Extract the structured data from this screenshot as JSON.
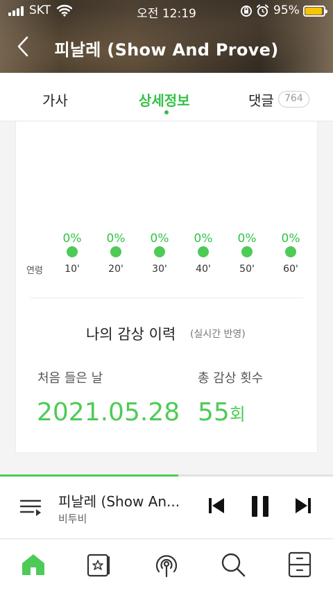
{
  "status_bar": {
    "carrier": "SKT",
    "time": "오전 12:19",
    "battery": "95%",
    "battery_level": 0.95
  },
  "header": {
    "title": "피날레 (Show And Prove)",
    "back_icon": "chevron-left-icon"
  },
  "tabs": {
    "lyrics": "가사",
    "detail": "상세정보",
    "comments": "댓글",
    "comments_count": "764",
    "active": "detail"
  },
  "age_chart": {
    "label": "연령",
    "groups": [
      {
        "tick": "10'",
        "pct": "0%"
      },
      {
        "tick": "20'",
        "pct": "0%"
      },
      {
        "tick": "30'",
        "pct": "0%"
      },
      {
        "tick": "40'",
        "pct": "0%"
      },
      {
        "tick": "50'",
        "pct": "0%"
      },
      {
        "tick": "60'",
        "pct": "0%"
      }
    ]
  },
  "history": {
    "title": "나의 감상 이력",
    "subtitle": "(실시간 반영)",
    "first_label": "처음 들은 날",
    "first_value": "2021.05.28",
    "total_label": "총 감상 횟수",
    "total_value": "55",
    "total_unit": "회"
  },
  "player": {
    "title": "피날레 (Show An...",
    "artist": "비투비",
    "progress": 0.535
  },
  "colors": {
    "accent": "#32c246",
    "accent_light": "#4ecb56"
  },
  "nav": [
    "home-icon",
    "storage-icon",
    "podcast-icon",
    "search-icon",
    "drawer-icon"
  ]
}
